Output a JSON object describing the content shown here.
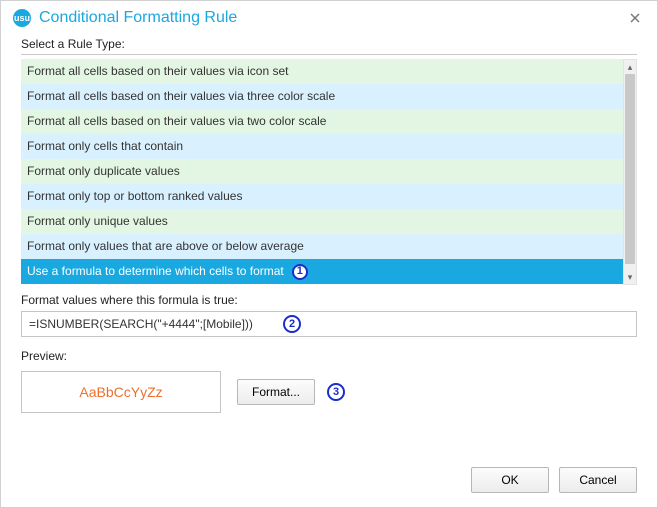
{
  "titlebar": {
    "badge": "usu",
    "title": "Conditional Formatting Rule"
  },
  "labels": {
    "select_rule": "Select a Rule Type:",
    "formula_label": "Format values where this formula is true:",
    "preview_label": "Preview:"
  },
  "rule_types": [
    "Format all cells based on their values via icon set",
    "Format all cells based on their values via three color scale",
    "Format all cells based on their values via two color scale",
    "Format only cells that contain",
    "Format only duplicate values",
    "Format only top or bottom ranked values",
    "Format only unique values",
    "Format only values that are above or below average",
    "Use a formula to determine which cells to format"
  ],
  "selected_rule_index": 8,
  "formula_value": "=ISNUMBER(SEARCH(\"+4444\";[Mobile]))",
  "preview_sample": "AaBbCcYyZz",
  "buttons": {
    "format": "Format...",
    "ok": "OK",
    "cancel": "Cancel"
  },
  "callouts": {
    "one": "1",
    "two": "2",
    "three": "3"
  }
}
